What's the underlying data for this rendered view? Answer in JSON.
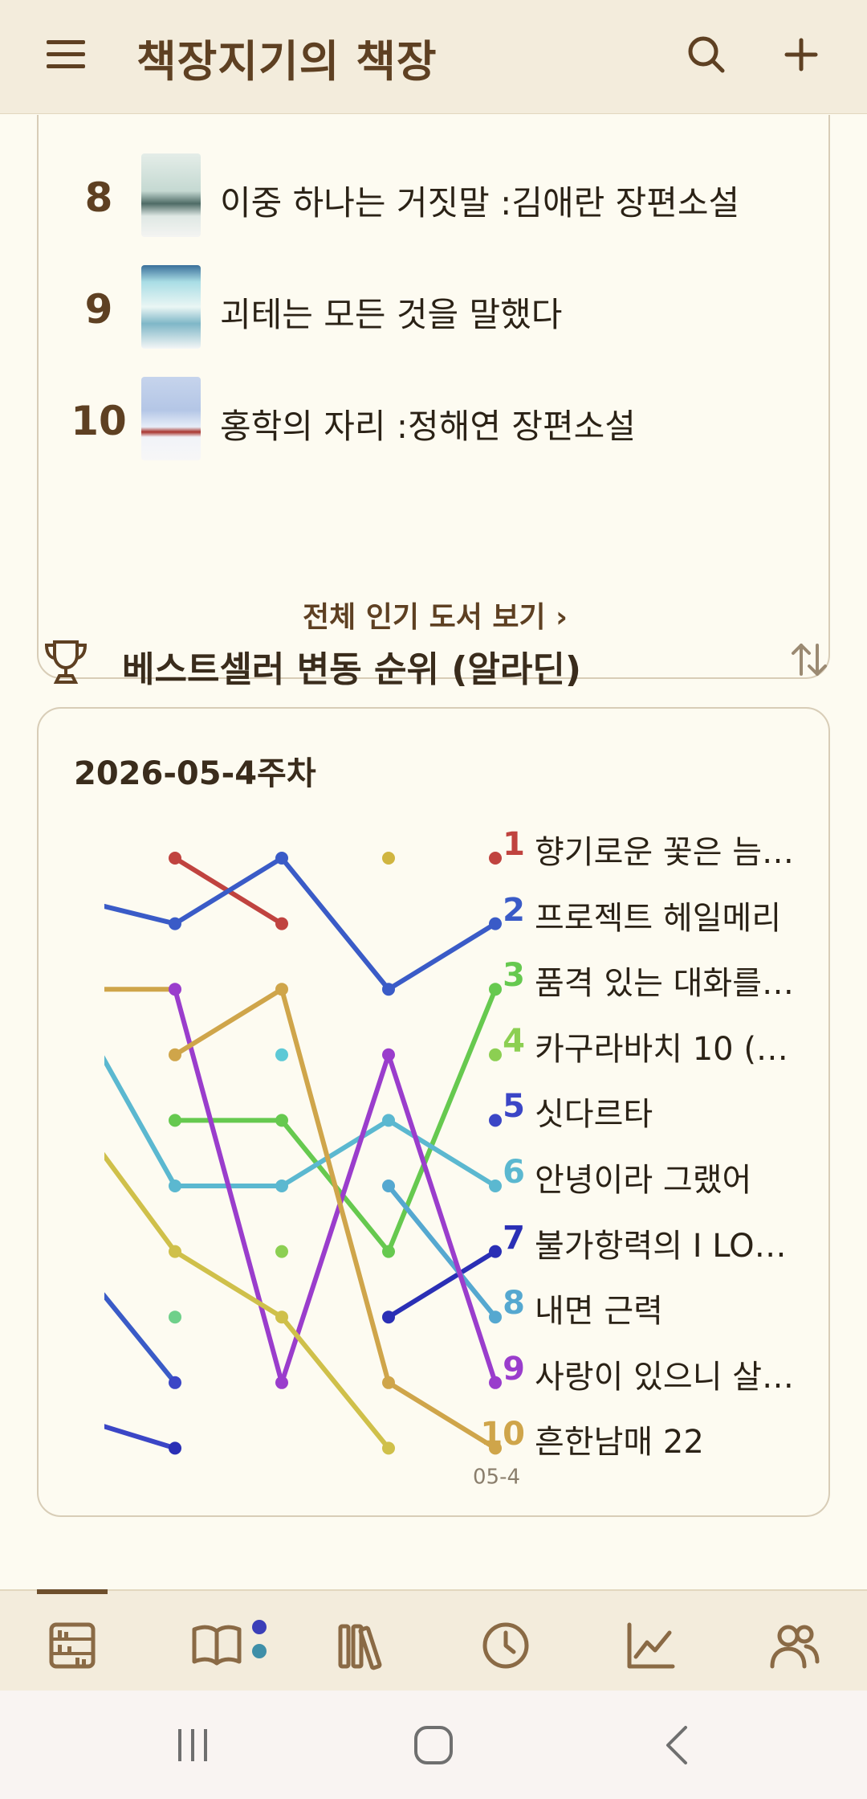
{
  "app_bar": {
    "title": "책장지기의 책장"
  },
  "popular": {
    "books": [
      {
        "rank": "8",
        "title": "이중 하나는 거짓말 :김애란 장편소설"
      },
      {
        "rank": "9",
        "title": "괴테는 모든 것을 말했다"
      },
      {
        "rank": "10",
        "title": "홍학의 자리 :정해연 장편소설"
      }
    ],
    "see_all": "전체 인기 도서 보기 ›"
  },
  "bestseller": {
    "section_title": "베스트셀러 변동 순위 (알라딘)",
    "week": "2026-05-4주차",
    "x_tick_label": "05-4",
    "legend": [
      {
        "rank": "1",
        "name": "향기로운 꽃은 늠…",
        "color": "#c0433f"
      },
      {
        "rank": "2",
        "name": "프로젝트 헤일메리",
        "color": "#3a5bc7"
      },
      {
        "rank": "3",
        "name": "품격 있는 대화를…",
        "color": "#66c94f"
      },
      {
        "rank": "4",
        "name": "카구라바치 10 (…",
        "color": "#8ccf52"
      },
      {
        "rank": "5",
        "name": "싯다르타",
        "color": "#3b46c6"
      },
      {
        "rank": "6",
        "name": "안녕이라 그랬어",
        "color": "#5bb8d0"
      },
      {
        "rank": "7",
        "name": "불가항력의 I LO…",
        "color": "#2a2fb5"
      },
      {
        "rank": "8",
        "name": "내면 근력",
        "color": "#55a8d0"
      },
      {
        "rank": "9",
        "name": "사랑이 있으니 살…",
        "color": "#9a3dcc"
      },
      {
        "rank": "10",
        "name": "흔한남매 22",
        "color": "#cfa54a"
      }
    ]
  },
  "chart_data": {
    "type": "line",
    "title": "2026-05-4주차",
    "x": [
      "",
      "",
      "",
      "05-4"
    ],
    "y_inverted": true,
    "ylim": [
      1,
      10
    ],
    "series": [
      {
        "name": "향기로운 꽃은 늠…",
        "color": "#c0433f",
        "values": [
          1,
          2,
          null,
          1
        ]
      },
      {
        "name": "프로젝트 헤일메리",
        "color": "#3a5bc7",
        "values": [
          2,
          1,
          3,
          2
        ]
      },
      {
        "name": "품격 있는 대화를…",
        "color": "#66c94f",
        "values": [
          5,
          5,
          7,
          3
        ]
      },
      {
        "name": "카구라바치 10 (…",
        "color": "#8ccf52",
        "values": [
          null,
          7,
          null,
          4
        ]
      },
      {
        "name": "싯다르타",
        "color": "#3b46c6",
        "values": [
          9,
          null,
          null,
          5
        ]
      },
      {
        "name": "안녕이라 그랬어",
        "color": "#5bb8d0",
        "values": [
          6,
          6,
          5,
          6
        ]
      },
      {
        "name": "불가항력의 I LO…",
        "color": "#2a2fb5",
        "values": [
          10,
          null,
          8,
          7
        ]
      },
      {
        "name": "내면 근력",
        "color": "#55a8d0",
        "values": [
          null,
          null,
          6,
          8
        ]
      },
      {
        "name": "사랑이 있으니 살…",
        "color": "#9a3dcc",
        "values": [
          3,
          9,
          4,
          9
        ]
      },
      {
        "name": "흔한남매 22",
        "color": "#cfa54a",
        "values": [
          4,
          3,
          9,
          10
        ]
      },
      {
        "name": "",
        "color": "#cfc04a",
        "values": [
          7,
          8,
          10,
          null
        ]
      },
      {
        "name": "",
        "color": "#6fd08a",
        "values": [
          8,
          null,
          null,
          null
        ]
      },
      {
        "name": "",
        "color": "#5dc9d6",
        "values": [
          null,
          4,
          null,
          null
        ]
      },
      {
        "name": "",
        "color": "#d0b540",
        "values": [
          null,
          null,
          1,
          null
        ]
      }
    ]
  },
  "nav": {
    "tabs": [
      "bookshelf",
      "reading",
      "library",
      "history",
      "stats",
      "friends"
    ],
    "active": "bookshelf",
    "accent": "#6e4f2c"
  }
}
